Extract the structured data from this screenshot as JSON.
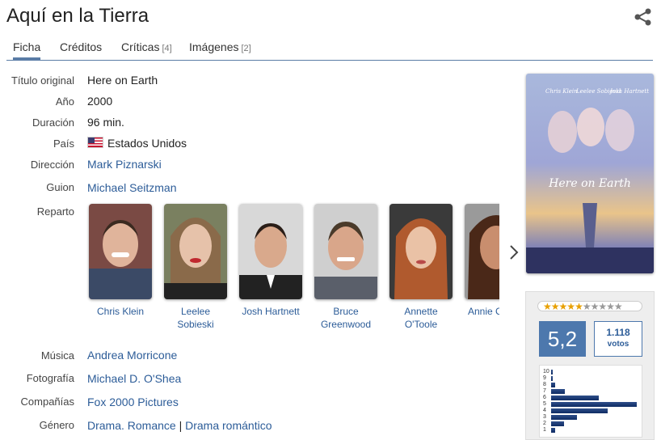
{
  "page": {
    "title": "Aquí en la Tierra"
  },
  "tabs": [
    {
      "label": "Ficha",
      "count": ""
    },
    {
      "label": "Créditos",
      "count": ""
    },
    {
      "label": "Críticas",
      "count": "[4]"
    },
    {
      "label": "Imágenes",
      "count": "[2]"
    }
  ],
  "details": {
    "original_title": {
      "label": "Título original",
      "value": "Here on Earth"
    },
    "year": {
      "label": "Año",
      "value": "2000"
    },
    "duration": {
      "label": "Duración",
      "value": "96 min."
    },
    "country": {
      "label": "País",
      "value": "Estados Unidos"
    },
    "director": {
      "label": "Dirección",
      "value": "Mark Piznarski"
    },
    "writer": {
      "label": "Guion",
      "value": "Michael Seitzman"
    },
    "cast": {
      "label": "Reparto"
    },
    "music": {
      "label": "Música",
      "value": "Andrea Morricone"
    },
    "photography": {
      "label": "Fotografía",
      "value": "Michael D. O'Shea"
    },
    "companies": {
      "label": "Compañías",
      "value": "Fox 2000 Pictures"
    },
    "genre": {
      "label": "Género",
      "value1": "Drama. Romance",
      "separator": "|",
      "value2": "Drama romántico"
    }
  },
  "cast": [
    {
      "name": "Chris Klein"
    },
    {
      "name": "Leelee Sobieski"
    },
    {
      "name": "Josh Hartnett"
    },
    {
      "name": "Bruce Greenwood"
    },
    {
      "name": "Annette O'Toole"
    },
    {
      "name": "Annie C"
    }
  ],
  "poster": {
    "top_names": [
      "Chris Klein",
      "Leelee Sobieski",
      "Josh Hartnett"
    ],
    "title": "Here on Earth"
  },
  "rating": {
    "stars": 5.2,
    "average": "5,2",
    "votes": "1.118",
    "votes_label": "votos",
    "histogram": {
      "labels": [
        "10",
        "9",
        "8",
        "7",
        "6",
        "5",
        "4",
        "3",
        "2",
        "1"
      ],
      "values": [
        1,
        2,
        5,
        16,
        56,
        100,
        66,
        30,
        15,
        5
      ]
    }
  },
  "colors": {
    "accent": "#4d78ad",
    "link": "#2c5c98"
  },
  "icons": {
    "share": "share-icon",
    "next": "chevron-right-icon",
    "flag": "us-flag-icon"
  }
}
